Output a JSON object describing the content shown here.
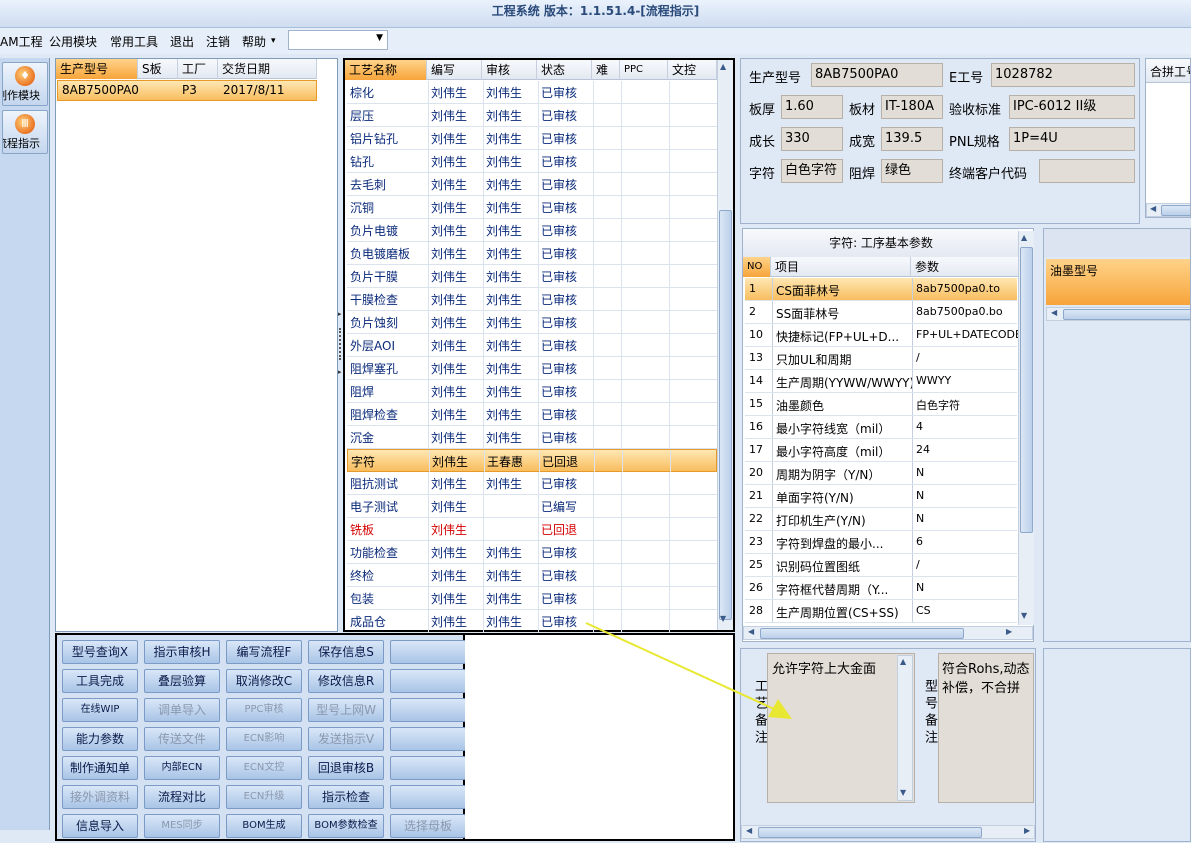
{
  "window": {
    "title": "工程系统 版本：1.1.51.4-[流程指示]"
  },
  "menu": {
    "items": [
      "AM工程",
      "公用模块",
      "常用工具",
      "退出",
      "注销",
      "帮助"
    ],
    "combo_value": ""
  },
  "leftnav": {
    "items": [
      "制作模块",
      "流程指示"
    ]
  },
  "orders": {
    "headers": [
      "生产型号",
      "S板",
      "工厂",
      "交货日期"
    ],
    "row": {
      "model": "8AB7500PA0",
      "s": "",
      "factory": "P3",
      "date": "2017/8/11"
    }
  },
  "process": {
    "headers": [
      "工艺名称",
      "编写",
      "审核",
      "状态",
      "难",
      "PPC",
      "文控"
    ],
    "rows": [
      {
        "name": "棕化",
        "writer": "刘伟生",
        "reviewer": "刘伟生",
        "status": "已审核"
      },
      {
        "name": "层压",
        "writer": "刘伟生",
        "reviewer": "刘伟生",
        "status": "已审核"
      },
      {
        "name": "铝片钻孔",
        "writer": "刘伟生",
        "reviewer": "刘伟生",
        "status": "已审核"
      },
      {
        "name": "钻孔",
        "writer": "刘伟生",
        "reviewer": "刘伟生",
        "status": "已审核"
      },
      {
        "name": "去毛刺",
        "writer": "刘伟生",
        "reviewer": "刘伟生",
        "status": "已审核"
      },
      {
        "name": "沉铜",
        "writer": "刘伟生",
        "reviewer": "刘伟生",
        "status": "已审核"
      },
      {
        "name": "负片电镀",
        "writer": "刘伟生",
        "reviewer": "刘伟生",
        "status": "已审核"
      },
      {
        "name": "负电镀磨板",
        "writer": "刘伟生",
        "reviewer": "刘伟生",
        "status": "已审核"
      },
      {
        "name": "负片干膜",
        "writer": "刘伟生",
        "reviewer": "刘伟生",
        "status": "已审核"
      },
      {
        "name": "干膜检查",
        "writer": "刘伟生",
        "reviewer": "刘伟生",
        "status": "已审核"
      },
      {
        "name": "负片蚀刻",
        "writer": "刘伟生",
        "reviewer": "刘伟生",
        "status": "已审核"
      },
      {
        "name": "外层AOI",
        "writer": "刘伟生",
        "reviewer": "刘伟生",
        "status": "已审核"
      },
      {
        "name": "阻焊塞孔",
        "writer": "刘伟生",
        "reviewer": "刘伟生",
        "status": "已审核"
      },
      {
        "name": "阻焊",
        "writer": "刘伟生",
        "reviewer": "刘伟生",
        "status": "已审核"
      },
      {
        "name": "阻焊检查",
        "writer": "刘伟生",
        "reviewer": "刘伟生",
        "status": "已审核"
      },
      {
        "name": "沉金",
        "writer": "刘伟生",
        "reviewer": "刘伟生",
        "status": "已审核"
      },
      {
        "name": "字符",
        "writer": "刘伟生",
        "reviewer": "王春惠",
        "status": "已回退"
      },
      {
        "name": "阻抗测试",
        "writer": "刘伟生",
        "reviewer": "刘伟生",
        "status": "已审核"
      },
      {
        "name": "电子测试",
        "writer": "刘伟生",
        "reviewer": "",
        "status": "已编写"
      },
      {
        "name": "铣板",
        "writer": "刘伟生",
        "reviewer": "",
        "status": "已回退"
      },
      {
        "name": "功能检查",
        "writer": "刘伟生",
        "reviewer": "刘伟生",
        "status": "已审核"
      },
      {
        "name": "终检",
        "writer": "刘伟生",
        "reviewer": "刘伟生",
        "status": "已审核"
      },
      {
        "name": "包装",
        "writer": "刘伟生",
        "reviewer": "刘伟生",
        "status": "已审核"
      },
      {
        "name": "成品仓",
        "writer": "刘伟生",
        "reviewer": "刘伟生",
        "status": "已审核"
      }
    ]
  },
  "buttons": [
    [
      "型号查询X",
      "指示审核H",
      "编写流程F",
      "保存信息S",
      ""
    ],
    [
      "工具完成",
      "叠层验算",
      "取消修改C",
      "修改信息R",
      ""
    ],
    [
      "在线WIP",
      "调单导入",
      "PPC审核",
      "型号上网W",
      ""
    ],
    [
      "能力参数",
      "传送文件",
      "ECN影响",
      "发送指示V",
      ""
    ],
    [
      "制作通知单",
      "内部ECN",
      "ECN文控",
      "回退审核B",
      ""
    ],
    [
      "接外调资料",
      "流程对比",
      "ECN升级",
      "指示检查",
      ""
    ],
    [
      "信息导入",
      "MES同步",
      "BOM生成",
      "BOM参数检查",
      "选择母板"
    ]
  ],
  "info": {
    "model_label": "生产型号",
    "model": "8AB7500PA0",
    "eno_label": "E工号",
    "eno": "1028782",
    "thickness_label": "板厚",
    "thickness": "1.60",
    "material_label": "板材",
    "material": "IT-180A",
    "standard_label": "验收标准",
    "standard": "IPC-6012 II级",
    "length_label": "成长",
    "length": "330",
    "width_label": "成宽",
    "width": "139.5",
    "pnl_label": "PNL规格",
    "pnl": "1P=4U",
    "char_label": "字符",
    "char": "白色字符",
    "mask_label": "阻焊",
    "mask": "绿色",
    "customer_label": "终端客户代码",
    "customer": "",
    "merge_label": "合拼工号"
  },
  "params": {
    "title": "字符: 工序基本参数",
    "headers": [
      "NO",
      "项目",
      "参数"
    ],
    "rows": [
      {
        "no": "1",
        "item": "CS面菲林号",
        "value": "8ab7500pa0.to"
      },
      {
        "no": "2",
        "item": "SS面菲林号",
        "value": "8ab7500pa0.bo"
      },
      {
        "no": "10",
        "item": "快捷标记(FP+UL+D...",
        "value": "FP+UL+DATECODE"
      },
      {
        "no": "13",
        "item": "只加UL和周期",
        "value": "/"
      },
      {
        "no": "14",
        "item": "生产周期(YYWW/WWYY)",
        "value": "WWYY"
      },
      {
        "no": "15",
        "item": "油墨颜色",
        "value": "白色字符"
      },
      {
        "no": "16",
        "item": "最小字符线宽（mil）",
        "value": "4"
      },
      {
        "no": "17",
        "item": "最小字符高度（mil）",
        "value": "24"
      },
      {
        "no": "20",
        "item": "周期为阴字（Y/N）",
        "value": "N"
      },
      {
        "no": "21",
        "item": "单面字符(Y/N)",
        "value": "N"
      },
      {
        "no": "22",
        "item": "打印机生产(Y/N)",
        "value": "N"
      },
      {
        "no": "23",
        "item": "字符到焊盘的最小...",
        "value": "6"
      },
      {
        "no": "25",
        "item": "识别码位置图纸",
        "value": "/"
      },
      {
        "no": "26",
        "item": "字符框代替周期（Y...",
        "value": "N"
      },
      {
        "no": "28",
        "item": "生产周期位置(CS+SS)",
        "value": "CS"
      }
    ]
  },
  "ink": {
    "header": "油墨型号"
  },
  "remarks": {
    "process_label": "工艺备注",
    "process_text": "允许字符上大金面",
    "model_label": "型号备注",
    "model_text": "符合Rohs,动态补偿，不合拼"
  }
}
